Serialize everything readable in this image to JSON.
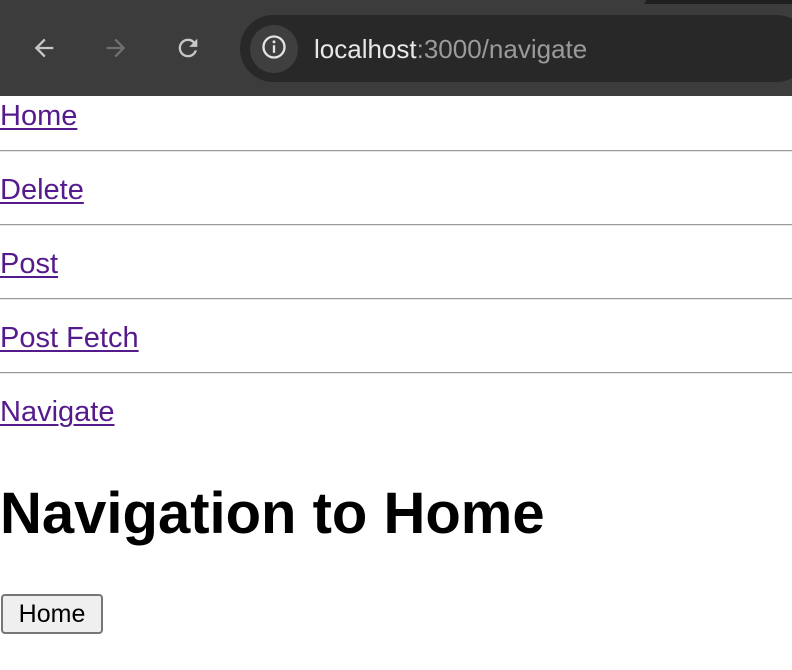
{
  "browser": {
    "back_icon": "arrow-left-icon",
    "forward_icon": "arrow-right-icon",
    "reload_icon": "reload-icon",
    "site_info_icon": "info-icon",
    "url_host": "localhost",
    "url_rest": ":3000/navigate",
    "forward_enabled": false,
    "colors": {
      "toolbar": "#3c3c3c",
      "omnibox": "#282828",
      "link": "#551a8b"
    }
  },
  "nav": {
    "links": [
      {
        "label": "Home"
      },
      {
        "label": "Delete"
      },
      {
        "label": "Post"
      },
      {
        "label": "Post Fetch"
      },
      {
        "label": "Navigate"
      }
    ]
  },
  "main": {
    "title": "Navigation to Home",
    "home_button_label": "Home"
  }
}
